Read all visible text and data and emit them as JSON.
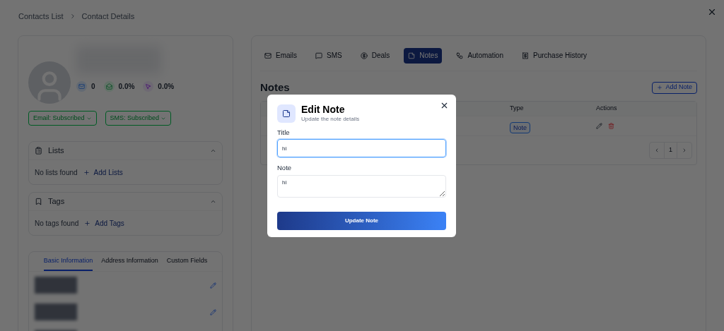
{
  "breadcrumb": [
    {
      "label": "Contacts List"
    },
    {
      "label": "Contact Details"
    }
  ],
  "stats": [
    {
      "kind": "email",
      "value": "0"
    },
    {
      "kind": "open",
      "value": "0.0%"
    },
    {
      "kind": "click",
      "value": "0.0%"
    }
  ],
  "subscriptions": [
    {
      "label": "Email: Subscribed"
    },
    {
      "label": "SMS: Subscribed"
    }
  ],
  "sections": [
    {
      "kind": "lists",
      "title": "Lists",
      "empty": "No lists found",
      "action": "Add Lists",
      "expanded": true
    },
    {
      "kind": "tags",
      "title": "Tags",
      "empty": "No tags found",
      "action": "Add Tags",
      "expanded": true
    }
  ],
  "info_tabs": [
    {
      "label": "Basic Information",
      "selected": true
    },
    {
      "label": "Address Information",
      "selected": false
    },
    {
      "label": "Custom Fields",
      "selected": false
    }
  ],
  "tabs": [
    {
      "kind": "email",
      "label": "Emails",
      "selected": false
    },
    {
      "kind": "sms",
      "label": "SMS",
      "selected": false
    },
    {
      "kind": "deals",
      "label": "Deals",
      "selected": false
    },
    {
      "kind": "notes",
      "label": "Notes",
      "selected": true
    },
    {
      "kind": "automation",
      "label": "Automation",
      "selected": false
    },
    {
      "kind": "purchase",
      "label": "Purchase History",
      "selected": false
    }
  ],
  "notes": {
    "title": "Notes",
    "add_button": "Add Note",
    "columns": [
      "Type",
      "Actions"
    ],
    "rows": [
      {
        "type": "Note"
      }
    ],
    "page": "1"
  },
  "modal": {
    "title": "Edit Note",
    "subtitle": "Update the note details",
    "fields": [
      {
        "kind": "input",
        "label": "Title",
        "value": "hi",
        "focused": true
      },
      {
        "kind": "textarea",
        "label": "Note",
        "value": "hi",
        "focused": false
      }
    ],
    "submit": "Update Note"
  }
}
